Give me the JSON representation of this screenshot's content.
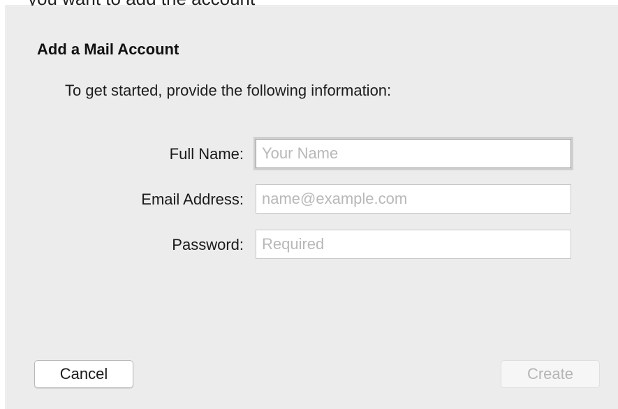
{
  "background_text": "you want to add the account",
  "dialog": {
    "title": "Add a Mail Account",
    "instructions": "To get started, provide the following information:",
    "fields": {
      "full_name": {
        "label": "Full Name:",
        "placeholder": "Your Name",
        "value": ""
      },
      "email": {
        "label": "Email Address:",
        "placeholder": "name@example.com",
        "value": ""
      },
      "password": {
        "label": "Password:",
        "placeholder": "Required",
        "value": ""
      }
    },
    "buttons": {
      "cancel": "Cancel",
      "create": "Create"
    }
  },
  "colors": {
    "dialog_background": "#ececec",
    "input_background": "#ffffff",
    "placeholder": "#b8b8b8",
    "disabled_text": "#b5b5b5"
  }
}
